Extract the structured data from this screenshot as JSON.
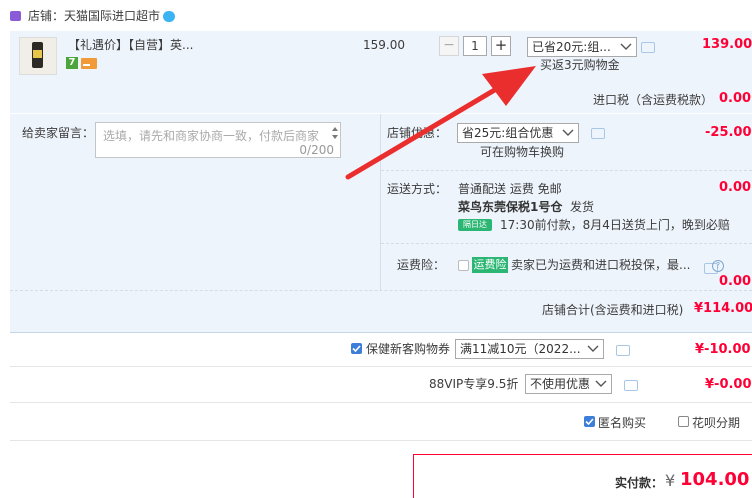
{
  "shop": {
    "prefix": "店铺：",
    "name": "天猫国际进口超市"
  },
  "item": {
    "title": "【礼遇价】【自营】英...",
    "tag7": "7",
    "unit_price": "159.00",
    "quantity": "1",
    "minus": "−",
    "plus": "+",
    "promo_select": "已省20元:组...",
    "promo_note": "买返3元购物金",
    "subtotal": "139.00"
  },
  "import_tax": {
    "label": "进口税（含运费税款）",
    "value": "0.00"
  },
  "message": {
    "label": "给卖家留言：",
    "placeholder": "选填，请先和商家协商一致，付款后商家",
    "count": "0/200"
  },
  "shop_discount": {
    "label": "店铺优惠：",
    "select": "省25元:组合优惠",
    "note": "可在购物车换购",
    "value": "-25.00"
  },
  "shipping": {
    "label": "运送方式：",
    "method": "普通配送 运费 免邮",
    "warehouse": "菜鸟东莞保税1号仓",
    "ship_suffix": "发货",
    "daily_badge": "隔日达",
    "daily_text": "17:30前付款，8月4日送货上门，晚到必赔",
    "value": "0.00"
  },
  "insurance": {
    "label": "运费险：",
    "badge": "运费险",
    "text": "卖家已为运费和进口税投保，最...",
    "value": "0.00"
  },
  "shop_total": {
    "label": "店铺合计(含运费和进口税)",
    "value": "¥114.00"
  },
  "coupon": {
    "label": "保健新客购物券",
    "select": "满11减10元（2022...",
    "value": "¥-10.00"
  },
  "vip": {
    "label": "88VIP专享9.5折",
    "select": "不使用优惠",
    "value": "¥-0.00"
  },
  "anonymous": {
    "label": "匿名购买"
  },
  "huabei": {
    "label": "花呗分期"
  },
  "pay": {
    "label": "实付款：",
    "currency": "¥",
    "value": "104.00"
  },
  "colors": {
    "accent": "#ff0036",
    "panel": "#eef4fb",
    "checkbox": "#3d7ed8"
  }
}
